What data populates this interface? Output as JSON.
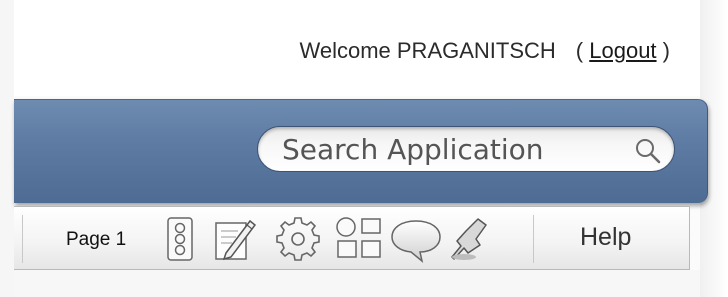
{
  "header": {
    "welcome_text": "Welcome PRAGANITSCH",
    "paren_open": "(",
    "logout_label": "Logout",
    "paren_close": ")"
  },
  "search": {
    "placeholder": "Search Application",
    "icon": "search-icon"
  },
  "toolbar": {
    "page_label": "Page 1",
    "icons": [
      "shared-components-icon",
      "edit-page-icon",
      "settings-gear-icon",
      "page-layout-icon",
      "comments-icon",
      "debug-pin-icon"
    ],
    "help_label": "Help"
  },
  "colors": {
    "header_bar": "#5c7aa2",
    "search_border": "#3e5476",
    "toolbar_border": "#b9b9b9"
  }
}
